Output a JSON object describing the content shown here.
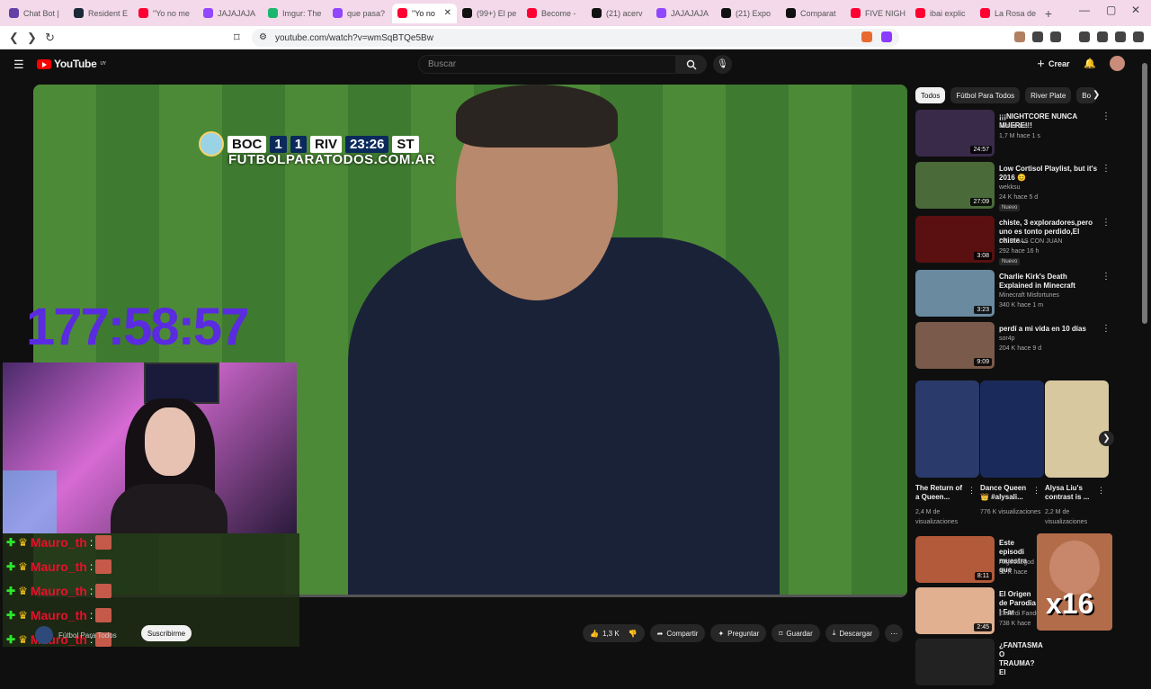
{
  "browser": {
    "tabs": [
      {
        "label": "Chat Bot |",
        "color": "#6441a5",
        "active": false
      },
      {
        "label": "Resident E",
        "color": "#1b2838",
        "active": false
      },
      {
        "label": "\"Yo no me",
        "color": "#ff0033",
        "active": false
      },
      {
        "label": "JAJAJAJA",
        "color": "#9146ff",
        "active": false
      },
      {
        "label": "Imgur: The",
        "color": "#1bb76e",
        "active": false
      },
      {
        "label": "que pasa?",
        "color": "#9146ff",
        "active": false
      },
      {
        "label": "\"Yo no",
        "color": "#ff0033",
        "active": true
      },
      {
        "label": "(99+) El pe",
        "color": "#111111",
        "active": false
      },
      {
        "label": "Become -",
        "color": "#ff0033",
        "active": false
      },
      {
        "label": "(21) acerv",
        "color": "#111111",
        "active": false
      },
      {
        "label": "JAJAJAJA",
        "color": "#9146ff",
        "active": false
      },
      {
        "label": "(21) Expo",
        "color": "#111111",
        "active": false
      },
      {
        "label": "Comparat",
        "color": "#111111",
        "active": false
      },
      {
        "label": "FIVE NIGH",
        "color": "#ff0033",
        "active": false
      },
      {
        "label": "ibai explic",
        "color": "#ff0033",
        "active": false
      },
      {
        "label": "La Rosa de",
        "color": "#ff0033",
        "active": false
      }
    ],
    "url": "youtube.com/watch?v=wmSqBTQe5Bw"
  },
  "youtube": {
    "logo_text": "YouTube",
    "logo_region": "UY",
    "search_placeholder": "Buscar",
    "create_label": "Crear",
    "video": {
      "score_home": "BOC",
      "score_home_goals": "1",
      "score_away_goals": "1",
      "score_away": "RIV",
      "score_time": "23:26",
      "score_half": "ST",
      "watermark": "FUTBOLPARATODOS.COM.AR"
    },
    "channel_name": "Fútbol Para Todos",
    "subscribe_label": "Suscribirme",
    "actions": {
      "likes": "1,3 K",
      "share": "Compartir",
      "ask": "Preguntar",
      "save": "Guardar",
      "download": "Descargar"
    },
    "chips": [
      "Todos",
      "Fútbol Para Todos",
      "River Plate",
      "Bo"
    ],
    "recommendations": [
      {
        "title": "¡¡¡NIGHTCORE NUNCA MUERE!!!",
        "channel": "luvmamimi",
        "meta": "1,7 M  hace 1 s",
        "duration": "24:57",
        "badge": "",
        "thumb": "#3a2a4a"
      },
      {
        "title": "Low Cortisol Playlist, but it's 2016 😊",
        "channel": "wekksu",
        "meta": "24 K  hace 5 d",
        "duration": "27:09",
        "badge": "Nuevo",
        "thumb": "#4a6a3a"
      },
      {
        "title": "chiste, 3 exploradores,pero uno es tonto perdido,El chiste ...",
        "channel": "DE RISAS CON JUAN",
        "meta": "292  hace 16 h",
        "duration": "3:08",
        "badge": "Nuevo",
        "thumb": "#5a1010"
      },
      {
        "title": "Charlie Kirk's Death Explained in Minecraft",
        "channel": "Minecraft Misfortunes",
        "meta": "340 K  hace 1 m",
        "duration": "3:23",
        "badge": "",
        "thumb": "#6a8aa0"
      },
      {
        "title": "perdí a mi vida en 10 días",
        "channel": "sor4p",
        "meta": "204 K  hace 9 d",
        "duration": "9:09",
        "badge": "",
        "thumb": "#7a5a4a"
      }
    ],
    "shorts": [
      {
        "title": "The Return of a Queen...",
        "views": "2,4 M de visualizaciones",
        "thumb": "#2a3a6a"
      },
      {
        "title": "Dance Queen 👑 #alysali...",
        "views": "776 K visualizaciones",
        "thumb": "#1a2a5a"
      },
      {
        "title": "Alysa Liu's contrast is ...",
        "views": "2,2 M de visualizaciones",
        "thumb": "#d8c8a0"
      }
    ],
    "more_recs": [
      {
        "title": "Este episodi muestra que",
        "channel": "Allgood2god",
        "meta": "53 K  hace",
        "duration": "8:11",
        "thumb": "#b25a3a"
      },
      {
        "title": "El Origen de Parodia | Far",
        "channel": "Escardi Fandube",
        "meta": "738 K  hace",
        "duration": "2:45",
        "thumb": "#e0b090"
      },
      {
        "title": "¿FANTASMA O TRAUMA? El",
        "channel": "",
        "meta": "",
        "duration": "",
        "thumb": "#222222"
      }
    ]
  },
  "overlay": {
    "timer": "177:58:57",
    "timer_color": "#5a2be0",
    "chat_user": "Mauro_th",
    "chat_lines": [
      "Mauro_th",
      "Mauro_th",
      "Mauro_th",
      "Mauro_th",
      "Mauro_th"
    ],
    "emote_label": "x16"
  }
}
